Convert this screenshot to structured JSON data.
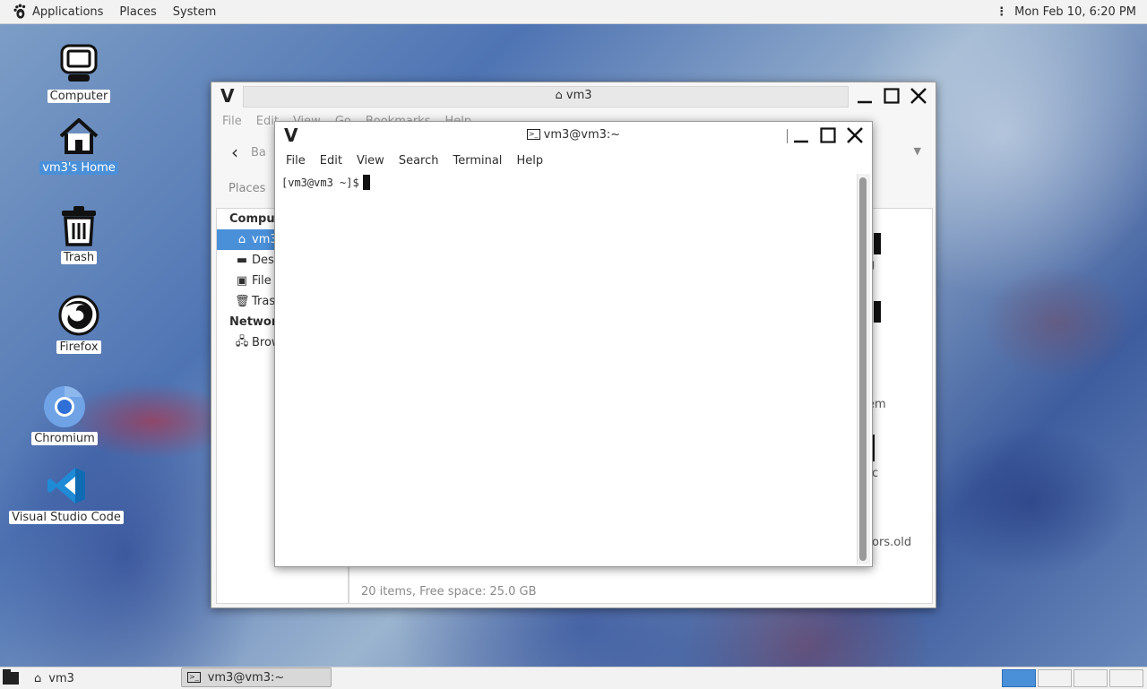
{
  "top_panel": {
    "menus": [
      "Applications",
      "Places",
      "System"
    ],
    "clock": "Mon Feb 10,  6:20 PM",
    "icons": {
      "logo": "gnome-foot-icon",
      "overflow": "vertical-ellipsis-icon"
    }
  },
  "desktop": {
    "icons": [
      {
        "label": "Computer",
        "icon": "computer-monitor-icon"
      },
      {
        "label": "vm3's Home",
        "icon": "home-icon",
        "selected": true
      },
      {
        "label": "Trash",
        "icon": "trash-icon"
      },
      {
        "label": "Firefox",
        "icon": "firefox-icon"
      },
      {
        "label": "Chromium",
        "icon": "chromium-icon"
      },
      {
        "label": "Visual Studio Code",
        "icon": "vscode-icon"
      }
    ]
  },
  "file_manager": {
    "title": "vm3",
    "menu": [
      "File",
      "Edit",
      "View",
      "Go",
      "Bookmarks",
      "Help"
    ],
    "back_label": "Ba",
    "places_label": "Places",
    "sidebar": {
      "computer_header": "Computer",
      "items": [
        {
          "label": "vm3",
          "icon": "home-icon",
          "selected": true
        },
        {
          "label": "Desktop",
          "icon": "folder-icon"
        },
        {
          "label": "File System",
          "icon": "drive-icon"
        },
        {
          "label": "Trash",
          "icon": "trash-icon"
        }
      ],
      "network_header": "Network",
      "network_items": [
        {
          "label": "Browse Network",
          "icon": "network-icon"
        }
      ]
    },
    "visible_fragments": [
      "g",
      "em",
      "c",
      "rors.old"
    ],
    "status": "20 items, Free space: 25.0 GB"
  },
  "terminal": {
    "title": "vm3@vm3:~",
    "menu": [
      "File",
      "Edit",
      "View",
      "Search",
      "Terminal",
      "Help"
    ],
    "prompt": "[vm3@vm3 ~]$"
  },
  "bottom_panel": {
    "tasks": [
      {
        "label": "vm3",
        "icon": "home-icon"
      },
      {
        "label": "vm3@vm3:~",
        "icon": "terminal-icon",
        "active": true
      }
    ],
    "workspaces": 4,
    "active_workspace": 1
  },
  "colors": {
    "accent": "#4a90d9",
    "panel": "#f2f2f2"
  }
}
